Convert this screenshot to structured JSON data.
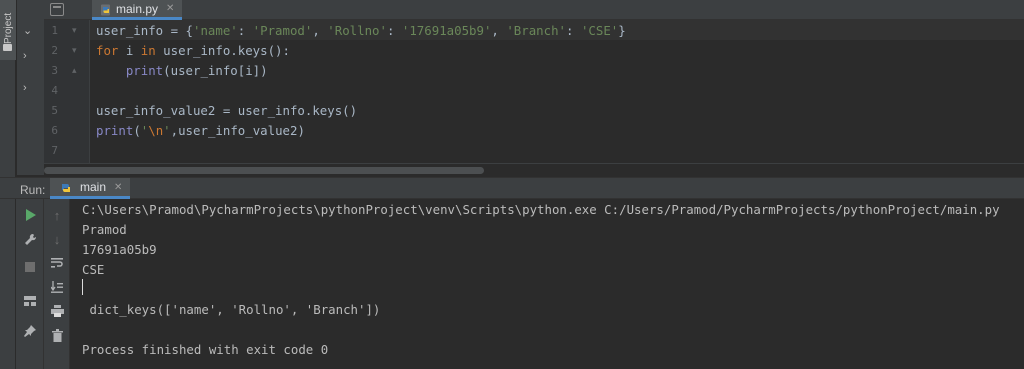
{
  "left_strip": {
    "project_tab_label": "Project",
    "icon": "folder-icon"
  },
  "editor": {
    "tab": {
      "label": "main.py",
      "icon": "python-file-icon",
      "close_icon": "close-icon"
    },
    "line_numbers": [
      "1",
      "2",
      "3",
      "4",
      "5",
      "6",
      "7"
    ],
    "lines": [
      [
        {
          "t": "user_info = {",
          "c": "plain"
        },
        {
          "t": "'name'",
          "c": "str"
        },
        {
          "t": ": ",
          "c": "plain"
        },
        {
          "t": "'Pramod'",
          "c": "str"
        },
        {
          "t": ", ",
          "c": "plain"
        },
        {
          "t": "'Rollno'",
          "c": "str"
        },
        {
          "t": ": ",
          "c": "plain"
        },
        {
          "t": "'17691a05b9'",
          "c": "str"
        },
        {
          "t": ", ",
          "c": "plain"
        },
        {
          "t": "'Branch'",
          "c": "str"
        },
        {
          "t": ": ",
          "c": "plain"
        },
        {
          "t": "'CSE'",
          "c": "str"
        },
        {
          "t": "}",
          "c": "plain"
        }
      ],
      [
        {
          "t": "for",
          "c": "kw"
        },
        {
          "t": " i ",
          "c": "plain"
        },
        {
          "t": "in",
          "c": "kw"
        },
        {
          "t": " user_info.keys():",
          "c": "plain"
        }
      ],
      [
        {
          "t": "    ",
          "c": "plain"
        },
        {
          "t": "print",
          "c": "fn"
        },
        {
          "t": "(user_info[i])",
          "c": "plain"
        }
      ],
      [],
      [
        {
          "t": "user_info_value2 = user_info.keys()",
          "c": "plain"
        }
      ],
      [
        {
          "t": "print",
          "c": "fn"
        },
        {
          "t": "(",
          "c": "plain"
        },
        {
          "t": "'",
          "c": "str"
        },
        {
          "t": "\\n",
          "c": "esc"
        },
        {
          "t": "'",
          "c": "str"
        },
        {
          "t": ",user_info_value2)",
          "c": "plain"
        }
      ],
      []
    ]
  },
  "run": {
    "label": "Run:",
    "tab": {
      "label": "main",
      "icon": "python-run-icon",
      "close_icon": "close-icon"
    },
    "console_lines": [
      "C:\\Users\\Pramod\\PycharmProjects\\pythonProject\\venv\\Scripts\\python.exe C:/Users/Pramod/PycharmProjects/pythonProject/main.py",
      "Pramod",
      "17691a05b9",
      "CSE",
      "",
      " dict_keys(['name', 'Rollno', 'Branch'])",
      "",
      "Process finished with exit code 0"
    ],
    "toolbar_icons": [
      "rerun-icon",
      "wrench-icon",
      "stop-icon",
      "layout-icon",
      "pin-icon"
    ],
    "toolbar2_icons": [
      "up-arrow-icon",
      "down-arrow-icon",
      "soft-wrap-icon",
      "scroll-to-end-icon",
      "print-icon",
      "trash-icon"
    ],
    "colors": {
      "run_green": "#59a869",
      "tab_underline": "#4a88c7"
    }
  }
}
